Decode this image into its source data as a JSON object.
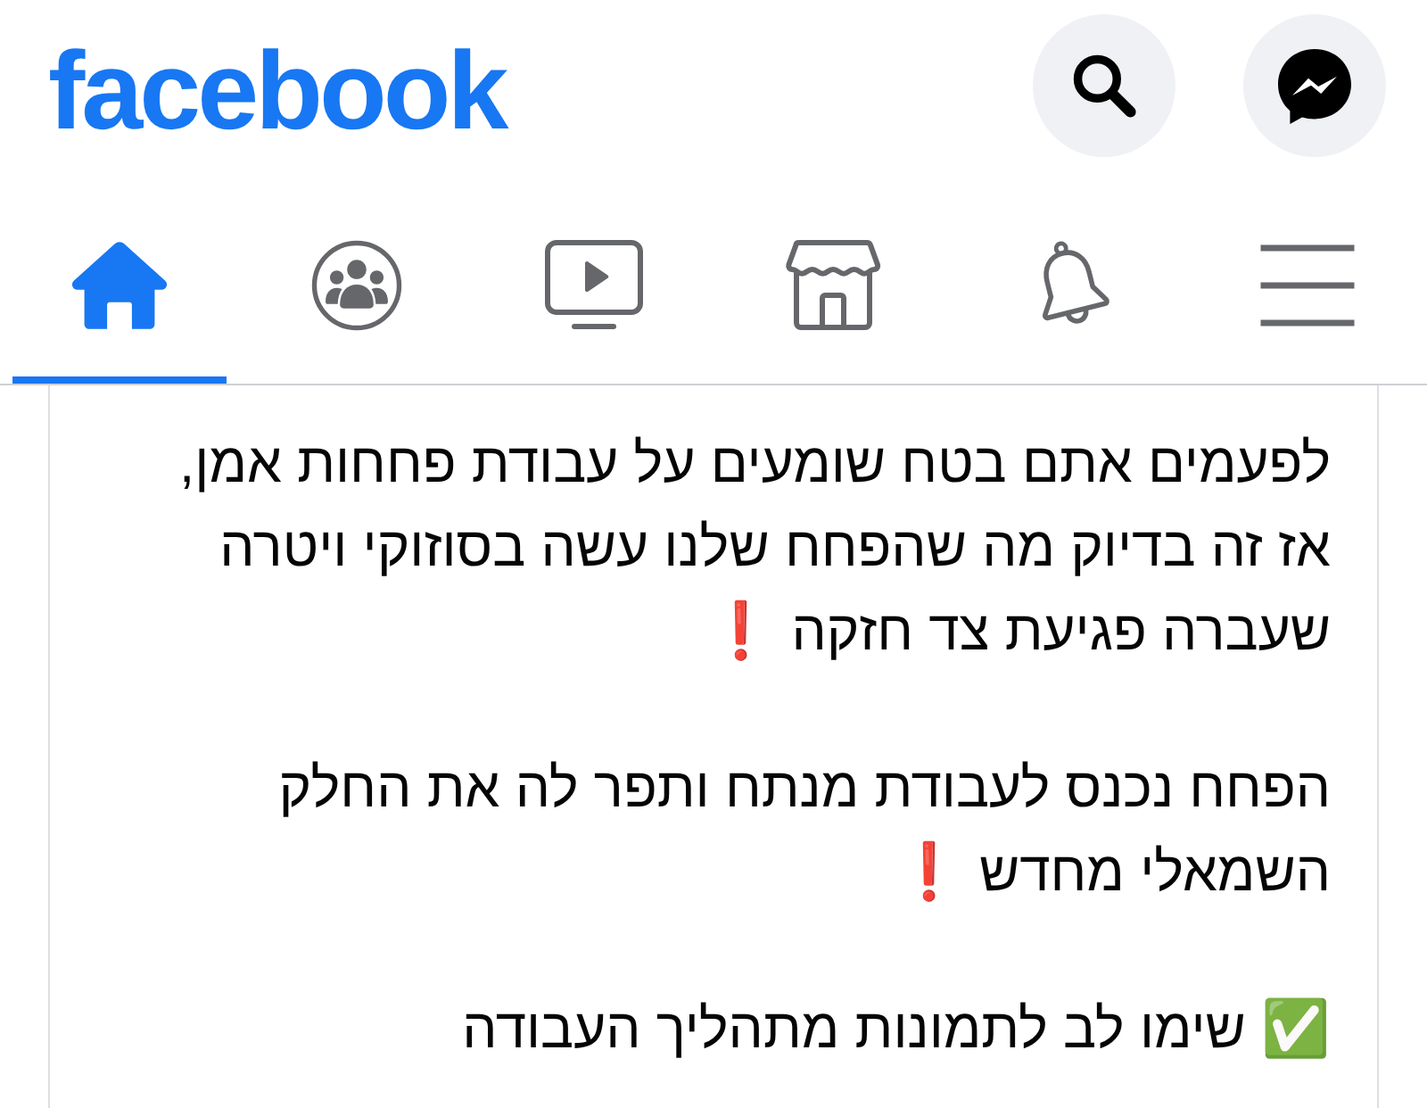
{
  "header": {
    "logo": "facebook"
  },
  "tabs": [
    {
      "kind": "home",
      "selected": true
    },
    {
      "kind": "groups",
      "selected": false
    },
    {
      "kind": "video",
      "selected": false
    },
    {
      "kind": "marketplace",
      "selected": false
    },
    {
      "kind": "notifications",
      "selected": false
    },
    {
      "kind": "menu",
      "selected": false
    }
  ],
  "post": {
    "paragraphs": [
      "לפעמים אתם בטח שומעים על עבודת פחחות אמן, אז זה בדיוק מה שהפחח שלנו עשה בסוזוקי ויטרה שעברה פגיעת צד חזקה ❗",
      "הפחח נכנס לעבודת מנתח ותפר לה את החלק השמאלי מחדש ❗",
      "✅ שימו לב לתמונות מתהליך העבודה"
    ]
  }
}
